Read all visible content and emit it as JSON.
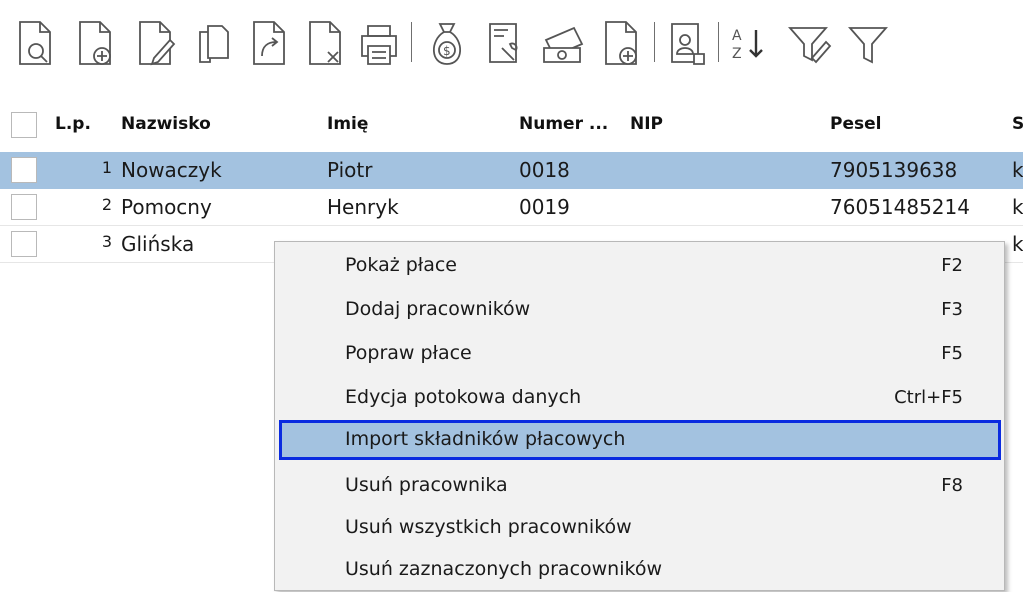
{
  "toolbar": {
    "icons": [
      "document-search-icon",
      "document-add-icon",
      "document-edit-icon",
      "documents-copy-icon",
      "document-export-icon",
      "document-delete-icon",
      "printer-icon",
      "money-bag-icon",
      "document-tools-icon",
      "money-stack-icon",
      "document-add-alt-icon",
      "document-person-icon",
      "sort-az-icon",
      "filter-edit-icon",
      "filter-icon"
    ]
  },
  "table": {
    "headers": {
      "lp": "L.p.",
      "nazwisko": "Nazwisko",
      "imie": "Imię",
      "numer": "Numer ...",
      "nip": "NIP",
      "pesel": "Pesel",
      "s": "S"
    },
    "rows": [
      {
        "lp": "1",
        "nazwisko": "Nowaczyk",
        "imie": "Piotr",
        "numer": "0018",
        "nip": "",
        "pesel": "7905139638",
        "s": "k"
      },
      {
        "lp": "2",
        "nazwisko": "Pomocny",
        "imie": "Henryk",
        "numer": "0019",
        "nip": "",
        "pesel": "76051485214",
        "s": "k"
      },
      {
        "lp": "3",
        "nazwisko": "Glińska",
        "imie": "",
        "numer": "",
        "nip": "",
        "pesel": "",
        "s": "k"
      }
    ]
  },
  "context_menu": {
    "items": [
      {
        "label": "Pokaż płace",
        "shortcut": "F2"
      },
      {
        "label": "Dodaj pracowników",
        "shortcut": "F3"
      },
      {
        "label": "Popraw płace",
        "shortcut": "F5"
      },
      {
        "label": "Edycja potokowa danych",
        "shortcut": "Ctrl+F5"
      },
      {
        "label": "Import składników płacowych",
        "shortcut": ""
      },
      {
        "label": "Usuń pracownika",
        "shortcut": "F8"
      },
      {
        "label": "Usuń wszystkich pracowników",
        "shortcut": ""
      },
      {
        "label": "Usuń zaznaczonych pracowników",
        "shortcut": ""
      }
    ]
  },
  "colors": {
    "selection": "#a3c2e0",
    "highlight_border": "#0a2be0"
  }
}
